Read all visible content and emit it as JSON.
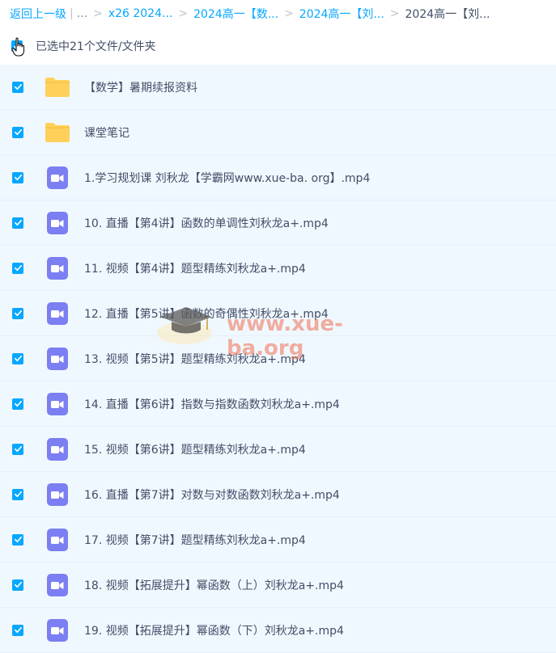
{
  "breadcrumb": {
    "back": "返回上一级",
    "ellipsis": "...",
    "crumbs": [
      "x26 2024...",
      "2024高一【数...",
      "2024高一【刘..."
    ],
    "current": "2024高一【刘..."
  },
  "selection": {
    "label": "已选中21个文件/文件夹"
  },
  "files": [
    {
      "type": "folder",
      "name": "【数学】暑期续报资料"
    },
    {
      "type": "folder",
      "name": "课堂笔记"
    },
    {
      "type": "video",
      "name": "1.学习规划课 刘秋龙【学霸网www.xue-ba. org】.mp4"
    },
    {
      "type": "video",
      "name": "10. 直播【第4讲】函数的单调性刘秋龙a+.mp4"
    },
    {
      "type": "video",
      "name": "11. 视频【第4讲】题型精练刘秋龙a+.mp4"
    },
    {
      "type": "video",
      "name": "12. 直播【第5讲】函数的奇偶性刘秋龙a+.mp4"
    },
    {
      "type": "video",
      "name": "13. 视频【第5讲】题型精练刘秋龙a+.mp4"
    },
    {
      "type": "video",
      "name": "14. 直播【第6讲】指数与指数函数刘秋龙a+.mp4"
    },
    {
      "type": "video",
      "name": "15. 视频【第6讲】题型精练刘秋龙a+.mp4"
    },
    {
      "type": "video",
      "name": "16. 直播【第7讲】对数与对数函数刘秋龙a+.mp4"
    },
    {
      "type": "video",
      "name": "17. 视频【第7讲】题型精练刘秋龙a+.mp4"
    },
    {
      "type": "video",
      "name": "18. 视频【拓展提升】幂函数（上）刘秋龙a+.mp4"
    },
    {
      "type": "video",
      "name": "19. 视频【拓展提升】幂函数（下）刘秋龙a+.mp4"
    }
  ],
  "watermark": {
    "text": "www.xue-ba.org"
  },
  "colors": {
    "accent": "#06a7ff",
    "row_selected": "#f0f8ff",
    "folder": "#ffd15a",
    "video": "#7b7ff2"
  }
}
